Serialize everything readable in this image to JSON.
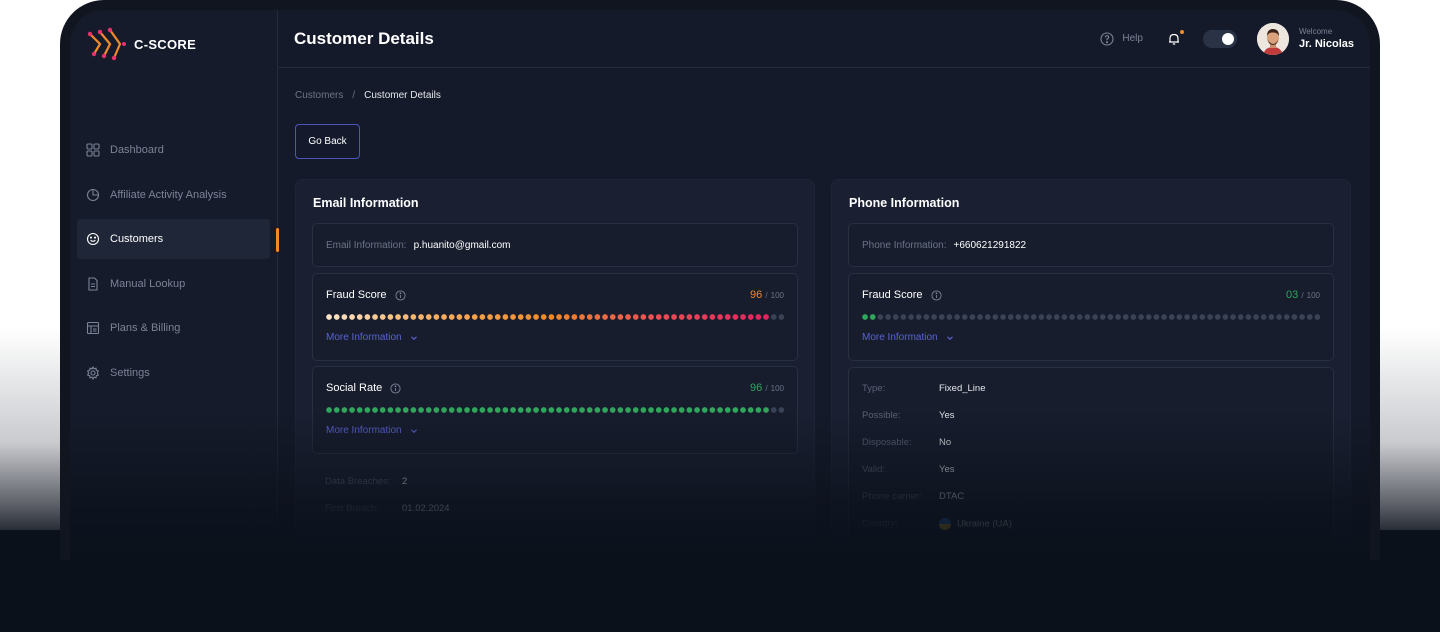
{
  "app": {
    "name": "C-SCORE",
    "brand_color": "#f08a2a",
    "accent_color": "#5a63d1"
  },
  "sidebar": {
    "items": [
      {
        "label": "Dashboard",
        "icon": "grid-icon",
        "active": false
      },
      {
        "label": "Affiliate Activity Analysis",
        "icon": "pie-chart-icon",
        "active": false
      },
      {
        "label": "Customers",
        "icon": "smile-icon",
        "active": true
      },
      {
        "label": "Manual Lookup",
        "icon": "document-icon",
        "active": false
      },
      {
        "label": "Plans & Billing",
        "icon": "billing-icon",
        "active": false
      },
      {
        "label": "Settings",
        "icon": "gear-icon",
        "active": false
      }
    ]
  },
  "header": {
    "title": "Customer Details",
    "help_label": "Help",
    "welcome": "Welcome",
    "user_name": "Jr. Nicolas",
    "theme_toggle_on": true
  },
  "breadcrumb": {
    "parent": "Customers",
    "separator": "/",
    "current": "Customer Details"
  },
  "go_back_label": "Go Back",
  "email_card": {
    "title": "Email Information",
    "info_label": "Email Information:",
    "info_value": "p.huanito@gmail.com",
    "fraud": {
      "label": "Fraud Score",
      "value": "96",
      "sep": "/",
      "max": "100",
      "fraction": 0.96,
      "color": "#f08a2a"
    },
    "social": {
      "label": "Social Rate",
      "value": "96",
      "sep": "/",
      "max": "100",
      "fraction": 0.96,
      "color": "#2fa65c"
    },
    "more_label": "More Information",
    "details": [
      {
        "key": "Data Breaches:",
        "value": "2"
      },
      {
        "key": "First Breach:",
        "value": "01.02.2024"
      }
    ]
  },
  "phone_card": {
    "title": "Phone Information",
    "info_label": "Phone Information:",
    "info_value": "+660621291822",
    "fraud": {
      "label": "Fraud Score",
      "value": "03",
      "sep": "/",
      "max": "100",
      "fraction": 0.03,
      "color": "#2fa65c"
    },
    "more_label": "More Information",
    "details": [
      {
        "key": "Type:",
        "value": "Fixed_Line"
      },
      {
        "key": "Possible:",
        "value": "Yes"
      },
      {
        "key": "Disposable:",
        "value": "No"
      },
      {
        "key": "Valid:",
        "value": "Yes"
      },
      {
        "key": "Phone carrier:",
        "value": "DTAC"
      },
      {
        "key": "Country:",
        "value": "Ukraine (UA)"
      }
    ]
  }
}
